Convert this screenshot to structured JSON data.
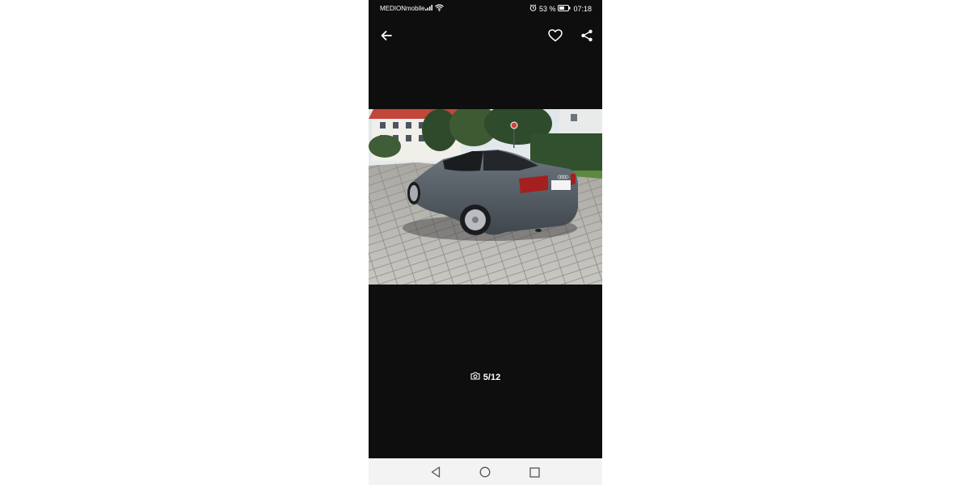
{
  "status_bar": {
    "carrier": "MEDIONmobile",
    "battery_percent": "53 %",
    "time": "07:18",
    "icons": [
      "signal-icon",
      "wifi-icon",
      "alarm-icon",
      "battery-icon"
    ]
  },
  "app_bar": {
    "icons": [
      "back-arrow-icon",
      "heart-icon",
      "share-icon"
    ]
  },
  "gallery": {
    "counter": "5/12",
    "counter_icon": "camera-icon"
  },
  "nav_bar": {
    "icons": [
      "nav-back-icon",
      "nav-home-icon",
      "nav-recents-icon"
    ]
  }
}
